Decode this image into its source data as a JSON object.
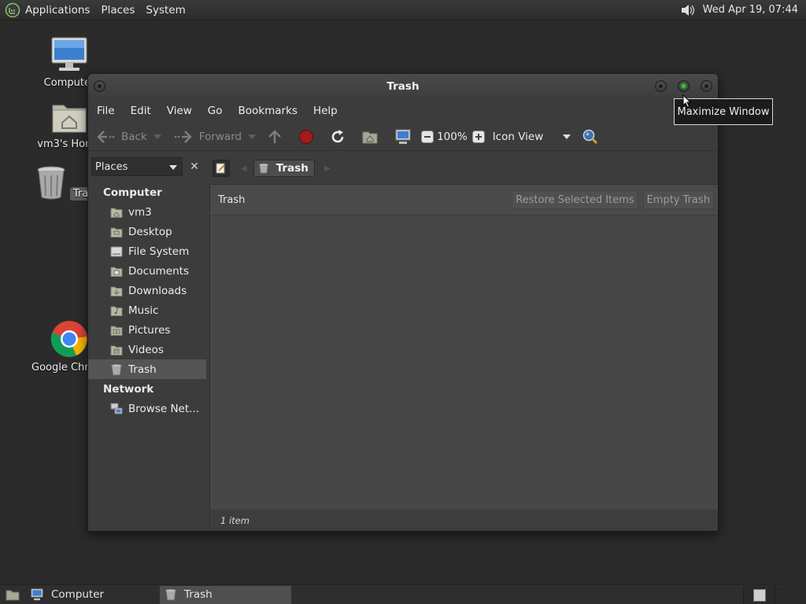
{
  "top_panel": {
    "menus": [
      "Applications",
      "Places",
      "System"
    ],
    "clock": "Wed Apr 19, 07:44"
  },
  "desktop": {
    "icons": [
      {
        "label": "Computer",
        "icon": "computer-icon"
      },
      {
        "label": "vm3's Home",
        "icon": "home-folder-icon"
      },
      {
        "label": "Trash",
        "icon": "trash-icon"
      },
      {
        "label": "Google Chrome",
        "icon": "chrome-icon"
      }
    ]
  },
  "window": {
    "title": "Trash",
    "menubar": [
      "File",
      "Edit",
      "View",
      "Go",
      "Bookmarks",
      "Help"
    ],
    "toolbar": {
      "back": "Back",
      "forward": "Forward",
      "zoom": "100%",
      "view_mode": "Icon View"
    },
    "sidepane": {
      "selector": "Places",
      "sections": [
        {
          "title": "Computer",
          "items": [
            {
              "label": "vm3",
              "icon": "home-folder-icon"
            },
            {
              "label": "Desktop",
              "icon": "desktop-folder-icon"
            },
            {
              "label": "File System",
              "icon": "drive-icon"
            },
            {
              "label": "Documents",
              "icon": "documents-folder-icon"
            },
            {
              "label": "Downloads",
              "icon": "downloads-folder-icon"
            },
            {
              "label": "Music",
              "icon": "music-folder-icon"
            },
            {
              "label": "Pictures",
              "icon": "pictures-folder-icon"
            },
            {
              "label": "Videos",
              "icon": "videos-folder-icon"
            },
            {
              "label": "Trash",
              "icon": "trash-icon",
              "selected": true
            }
          ]
        },
        {
          "title": "Network",
          "items": [
            {
              "label": "Browse Net...",
              "icon": "network-icon"
            }
          ]
        }
      ]
    },
    "location": {
      "crumb": "Trash"
    },
    "trash_bar": {
      "label": "Trash",
      "restore": "Restore Selected Items",
      "empty": "Empty Trash"
    },
    "status": "1 item"
  },
  "tooltip": "Maximize Window",
  "taskbar": {
    "tasks": [
      {
        "label": "Computer",
        "icon": "computer-icon",
        "active": false
      },
      {
        "label": "Trash",
        "icon": "trash-icon",
        "active": true
      }
    ]
  }
}
